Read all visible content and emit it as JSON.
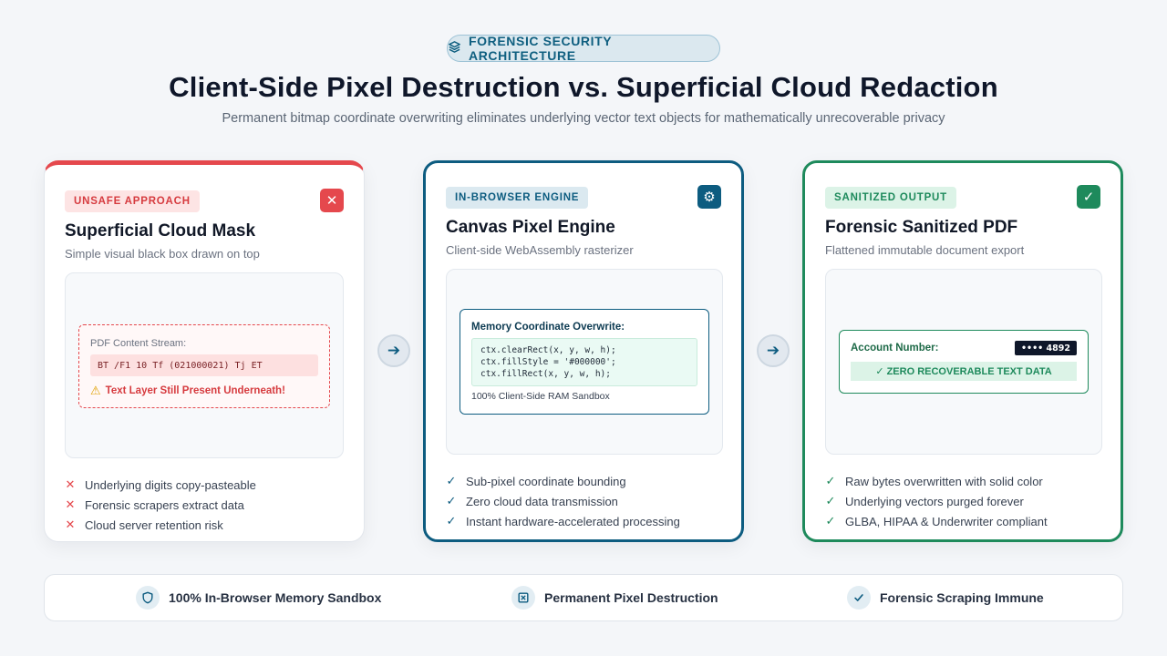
{
  "header": {
    "badge": "FORENSIC SECURITY ARCHITECTURE",
    "title": "Client-Side Pixel Destruction vs. Superficial Cloud Redaction",
    "subtitle": "Permanent bitmap coordinate overwriting eliminates underlying vector text objects for mathematically unrecoverable privacy"
  },
  "cards": [
    {
      "tag": "UNSAFE APPROACH",
      "corner": "✕",
      "title": "Superficial Cloud Mask",
      "subtitle": "Simple visual black box drawn on top",
      "panel": {
        "label": "PDF Content Stream:",
        "code": "BT /F1 10 Tf (021000021) Tj ET",
        "warning": "Text Layer Still Present Underneath!"
      },
      "features": [
        "Underlying digits copy-pasteable",
        "Forensic scrapers extract data",
        "Cloud server retention risk"
      ],
      "feature_mark": "✕"
    },
    {
      "tag": "IN-BROWSER ENGINE",
      "corner": "⚙",
      "title": "Canvas Pixel Engine",
      "subtitle": "Client-side WebAssembly rasterizer",
      "panel": {
        "label": "Memory Coordinate Overwrite:",
        "code": [
          "ctx.clearRect(x, y, w, h);",
          "ctx.fillStyle = '#000000';",
          "ctx.fillRect(x, y, w, h);"
        ],
        "footer": "100% Client-Side RAM Sandbox"
      },
      "features": [
        "Sub-pixel coordinate bounding",
        "Zero cloud data transmission",
        "Instant hardware-accelerated processing"
      ],
      "feature_mark": "✓"
    },
    {
      "tag": "SANITIZED OUTPUT",
      "corner": "✓",
      "title": "Forensic Sanitized PDF",
      "subtitle": "Flattened immutable document export",
      "panel": {
        "label": "Account Number:",
        "masked": "•••• 4892",
        "result": "✓ ZERO RECOVERABLE TEXT DATA"
      },
      "features": [
        "Raw bytes overwritten with solid color",
        "Underlying vectors purged forever",
        "GLBA, HIPAA & Underwriter compliant"
      ],
      "feature_mark": "✓"
    }
  ],
  "arrow_glyph": "➔",
  "footer": {
    "items": [
      "100% In-Browser Memory Sandbox",
      "Permanent Pixel Destruction",
      "Forensic Scraping Immune"
    ]
  },
  "colors": {
    "danger": "#e5484d",
    "engine": "#0d5c80",
    "success": "#1e8a5c"
  }
}
